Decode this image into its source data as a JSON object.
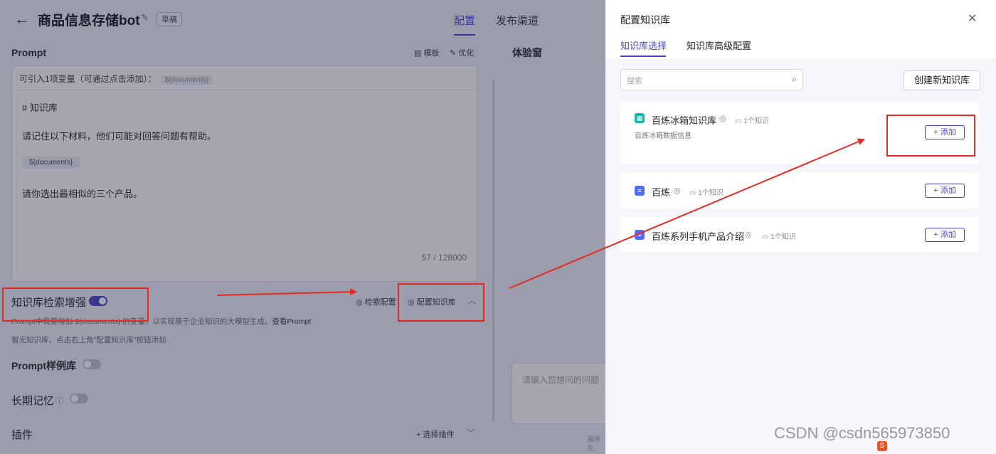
{
  "app": {
    "bot_title": "商品信息存储bot",
    "draft_badge": "草稿",
    "tabs": [
      "配置",
      "发布渠道"
    ]
  },
  "prompt": {
    "label": "Prompt",
    "template_link": "模板",
    "optimize_link": "优化",
    "variable_hint": "可引入1项变量（可通过点击添加）：",
    "variable_chip": "${documents}",
    "lines": [
      "# 知识库",
      "请记住以下材料，他们可能对回答问题有帮助。",
      "${documents}",
      "请你选出最相似的三个产品。"
    ],
    "counter": "57 / 128000"
  },
  "knowledge_enhance": {
    "label": "知识库检索增强",
    "enabled": true,
    "search_config_link": "检索配置",
    "config_kb_link": "配置知识库",
    "desc_prefix": "Prompt中需要增加 ${documents} 的变量，以实现基于企业知识的大模型生成。",
    "view_prompt_link": "查看Prompt",
    "empty_hint": "暂无知识库，点击右上角\"配置知识库\"按钮添加"
  },
  "prompt_library": {
    "label": "Prompt样例库",
    "enabled": false
  },
  "long_memory": {
    "label": "长期记忆",
    "enabled": false
  },
  "plugins": {
    "label": "插件",
    "select_link": "选择插件"
  },
  "experience": {
    "title": "体验窗",
    "input_placeholder": "请输入您想问的问题",
    "service_text": "服务生"
  },
  "drawer": {
    "title": "配置知识库",
    "tabs": [
      "知识库选择",
      "知识库高级配置"
    ],
    "search_placeholder": "搜索",
    "create_button": "创建新知识库",
    "add_label": "添加",
    "knowledge_bases": [
      {
        "name": "百炼冰箱知识库",
        "count": "1个知识",
        "desc": "百炼冰箱数据信息",
        "icon_color": "#14b8a6"
      },
      {
        "name": "百炼",
        "count": "1个知识",
        "desc": "",
        "icon_color": "#4f6ef7"
      },
      {
        "name": "百炼系列手机产品介绍",
        "count": "1个知识",
        "desc": "",
        "icon_color": "#4f6ef7"
      }
    ]
  },
  "watermark": "CSDN @csdn565973850",
  "colors": {
    "accent": "#4a43c9",
    "annotation_red": "#e62a24"
  }
}
